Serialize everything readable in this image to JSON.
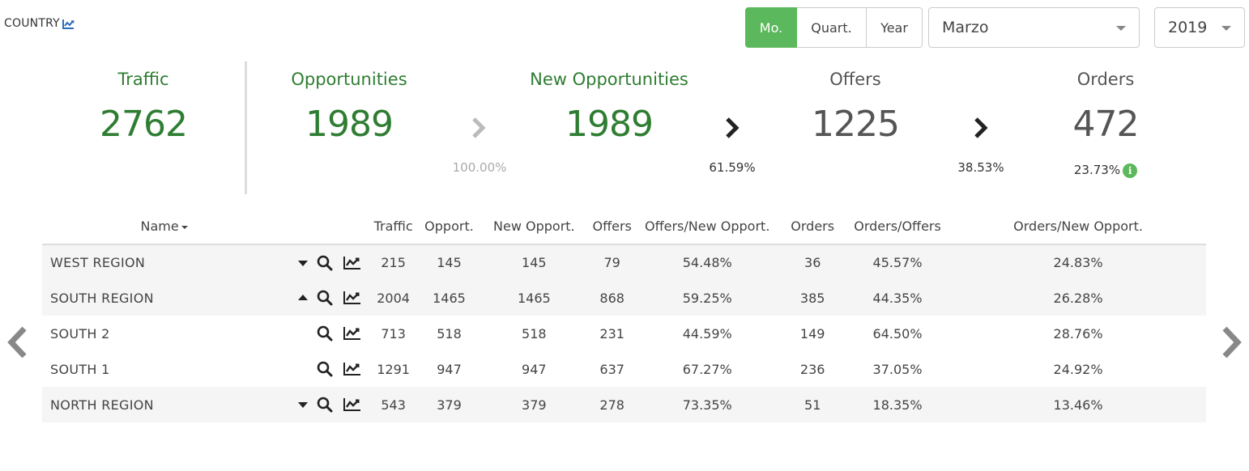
{
  "header": {
    "country_label": "COUNTRY",
    "country_icon": "line-chart-icon"
  },
  "period": {
    "buttons": [
      "Mo.",
      "Quart.",
      "Year"
    ],
    "active": "Mo."
  },
  "month_select": {
    "value": "Marzo"
  },
  "year_select": {
    "value": "2019"
  },
  "kpis": {
    "traffic": {
      "title": "Traffic",
      "value": "2762"
    },
    "opportunities": {
      "title": "Opportunities",
      "value": "1989"
    },
    "new_opportunities": {
      "title": "New Opportunities",
      "value": "1989"
    },
    "offers": {
      "title": "Offers",
      "value": "1225"
    },
    "orders": {
      "title": "Orders",
      "value": "472"
    }
  },
  "conversions": {
    "opp_to_new": "100.00%",
    "new_to_offers": "61.59%",
    "offers_to_orders": "38.53%",
    "orders_rate": "23.73%"
  },
  "colors": {
    "accent_green": "#5cb85c",
    "kpi_green": "#2e7d32"
  },
  "table": {
    "columns": [
      "Name",
      "Traffic",
      "Opport.",
      "New Opport.",
      "Offers",
      "Offers/New Opport.",
      "Orders",
      "Orders/Offers",
      "Orders/New Opport."
    ],
    "rows": [
      {
        "name": "WEST REGION",
        "toggle": "collapsed",
        "traffic": "215",
        "opport": "145",
        "new_opport": "145",
        "offers": "79",
        "offers_new": "54.48%",
        "orders": "36",
        "orders_offers": "45.57%",
        "orders_new": "24.83%"
      },
      {
        "name": "SOUTH REGION",
        "toggle": "expanded",
        "traffic": "2004",
        "opport": "1465",
        "new_opport": "1465",
        "offers": "868",
        "offers_new": "59.25%",
        "orders": "385",
        "orders_offers": "44.35%",
        "orders_new": "26.28%"
      },
      {
        "name": "SOUTH 2",
        "toggle": "none",
        "traffic": "713",
        "opport": "518",
        "new_opport": "518",
        "offers": "231",
        "offers_new": "44.59%",
        "orders": "149",
        "orders_offers": "64.50%",
        "orders_new": "28.76%"
      },
      {
        "name": "SOUTH 1",
        "toggle": "none",
        "traffic": "1291",
        "opport": "947",
        "new_opport": "947",
        "offers": "637",
        "offers_new": "67.27%",
        "orders": "236",
        "orders_offers": "37.05%",
        "orders_new": "24.92%"
      },
      {
        "name": "NORTH REGION",
        "toggle": "collapsed",
        "traffic": "543",
        "opport": "379",
        "new_opport": "379",
        "offers": "278",
        "offers_new": "73.35%",
        "orders": "51",
        "orders_offers": "18.35%",
        "orders_new": "13.46%"
      }
    ]
  }
}
